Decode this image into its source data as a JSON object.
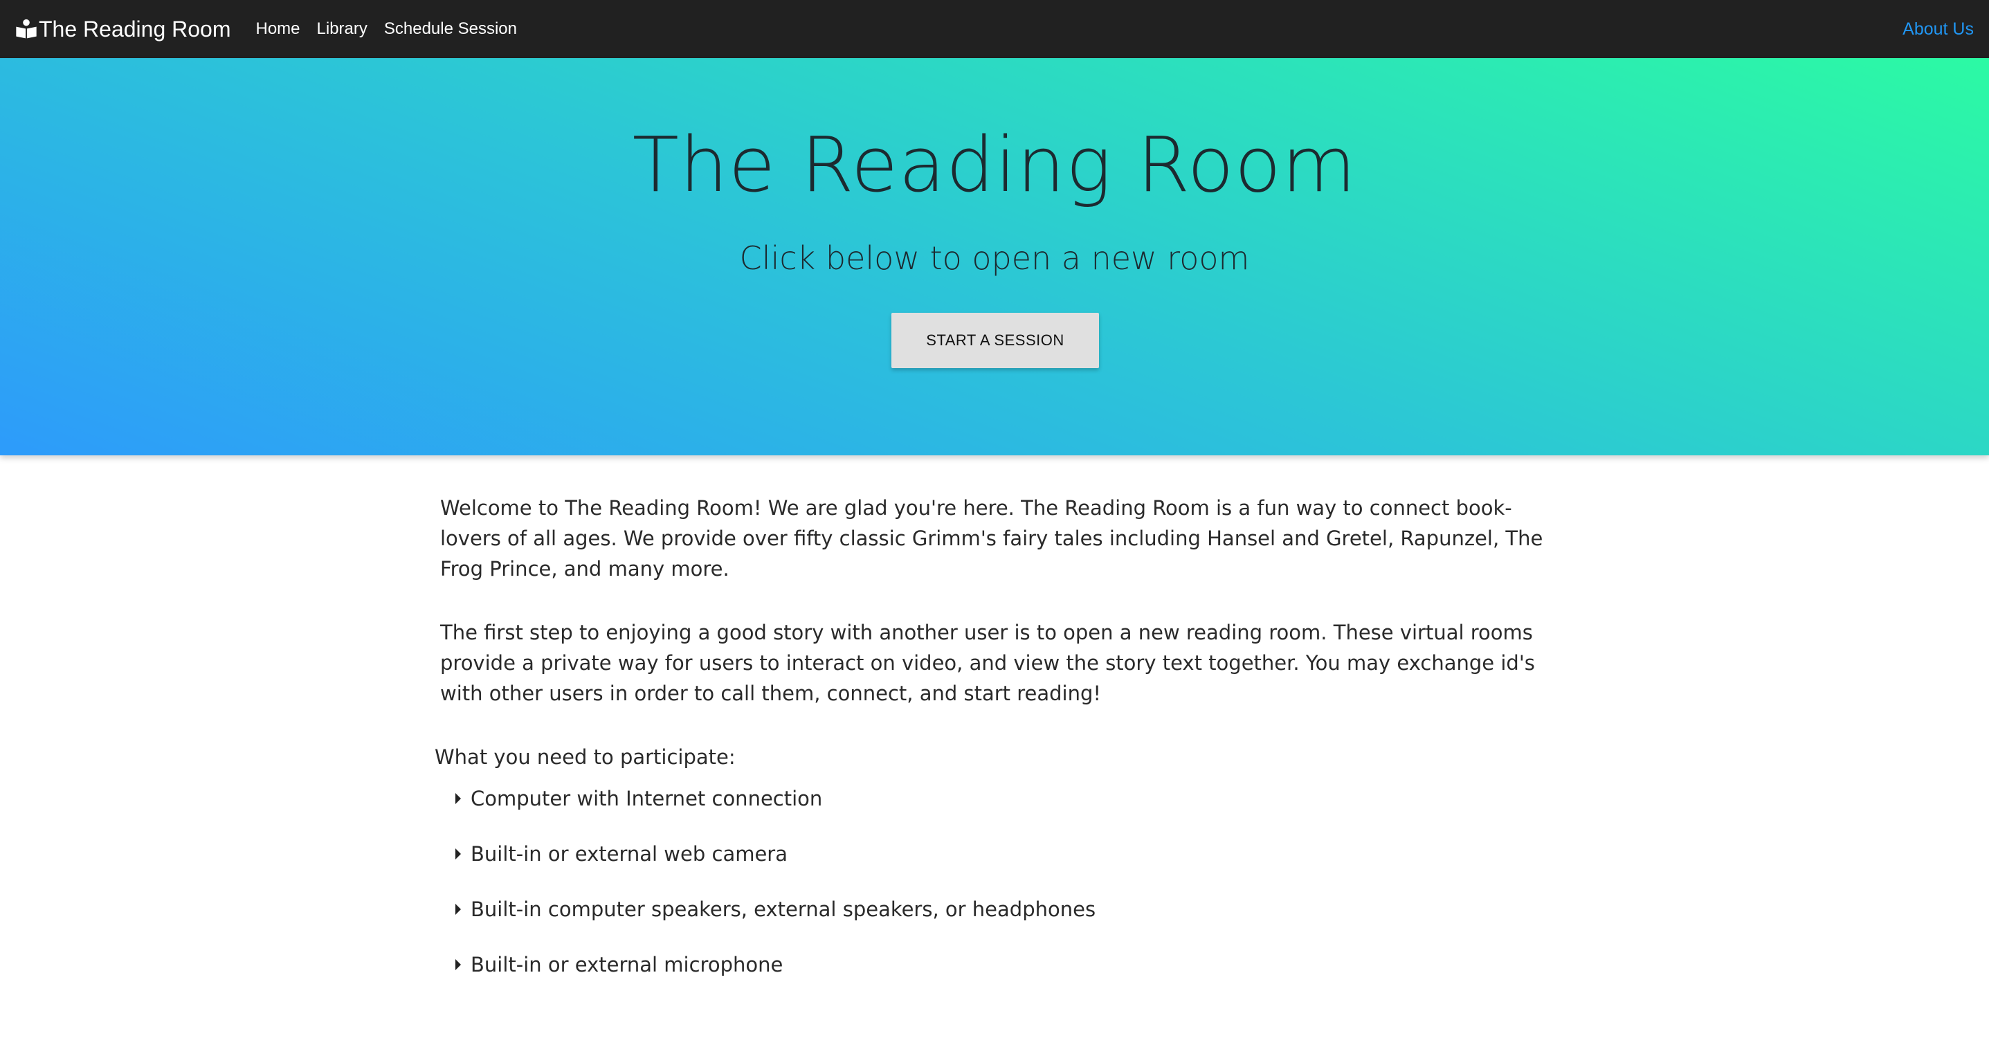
{
  "navbar": {
    "brand": "The Reading Room",
    "brand_icon": "reading-person-icon",
    "links": [
      "Home",
      "Library",
      "Schedule Session"
    ],
    "right_link": "About Us",
    "accent_color": "#2196f3"
  },
  "hero": {
    "title": "The Reading Room",
    "subtitle": "Click below to open a new room",
    "button_label": "START A SESSION",
    "gradient_colors": [
      "#2d9bfb",
      "#2cc4d8",
      "#2cfaa4"
    ]
  },
  "content": {
    "paragraphs": [
      "Welcome to The Reading Room! We are glad you're here. The Reading Room is a fun way to connect book-lovers of all ages. We provide over fifty classic Grimm's fairy tales including Hansel and Gretel, Rapunzel, The Frog Prince, and many more.",
      "The first step to enjoying a good story with another user is to open a new reading room. These virtual rooms provide a private way for users to interact on video, and view the story text together. You may exchange id's with other users in order to call them, connect, and start reading!"
    ],
    "requirements_heading": "What you need to participate:",
    "requirements": [
      "Computer with Internet connection",
      "Built-in or external web camera",
      "Built-in computer speakers, external speakers, or headphones",
      "Built-in or external microphone"
    ]
  }
}
